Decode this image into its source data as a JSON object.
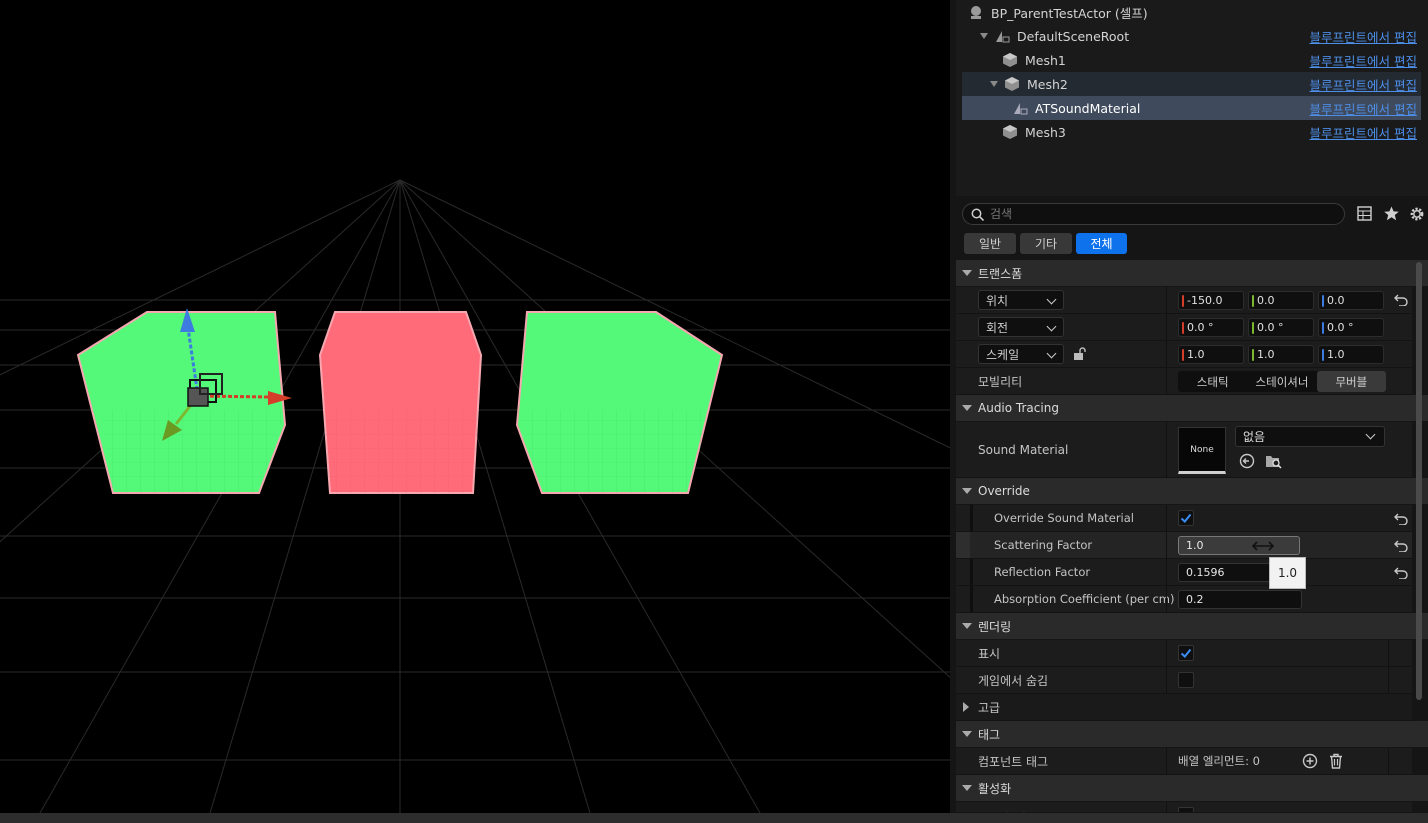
{
  "tree": {
    "items": [
      {
        "name": "BP_ParentTestActor (셀프)",
        "link": ""
      },
      {
        "name": "DefaultSceneRoot",
        "link": "블루프린트에서 편집"
      },
      {
        "name": "Mesh1",
        "link": "블루프린트에서 편집"
      },
      {
        "name": "Mesh2",
        "link": "블루프린트에서 편집"
      },
      {
        "name": "ATSoundMaterial",
        "link": "블루프린트에서 편집"
      },
      {
        "name": "Mesh3",
        "link": "블루프린트에서 편집"
      }
    ]
  },
  "search": {
    "placeholder": "검색"
  },
  "filter_tabs": [
    "일반",
    "기타",
    "전체"
  ],
  "transform": {
    "title": "트랜스폼",
    "location": {
      "label": "위치",
      "x": "-150.0",
      "y": "0.0",
      "z": "0.0"
    },
    "rotation": {
      "label": "회전",
      "x": "0.0 °",
      "y": "0.0 °",
      "z": "0.0 °"
    },
    "scale": {
      "label": "스케일",
      "x": "1.0",
      "y": "1.0",
      "z": "1.0"
    },
    "mobility": {
      "label": "모빌리티",
      "options": [
        "스태틱",
        "스테이셔너",
        "무버블"
      ],
      "selected": "무버블"
    }
  },
  "audio_tracing": {
    "title": "Audio Tracing",
    "sound_material": {
      "label": "Sound Material",
      "thumb": "None",
      "value": "없음"
    }
  },
  "override": {
    "title": "Override",
    "override_sound_material": {
      "label": "Override Sound Material",
      "checked": true
    },
    "scattering_factor": {
      "label": "Scattering Factor",
      "value": "1.0"
    },
    "reflection_factor": {
      "label": "Reflection Factor",
      "value": "0.1596"
    },
    "absorption": {
      "label": "Absorption Coefficient (per cm)",
      "value": "0.2"
    },
    "tooltip": "1.0"
  },
  "rendering": {
    "title": "렌더링",
    "visible": {
      "label": "표시",
      "checked": true
    },
    "hidden_in_game": {
      "label": "게임에서 숨김",
      "checked": false
    }
  },
  "advanced": {
    "title": "고급"
  },
  "tags": {
    "title": "태그",
    "component_tags": {
      "label": "컴포넌트 태그",
      "value": "배열 엘리먼트: 0"
    }
  },
  "activation": {
    "title": "활성화",
    "partial_label": "자동 활성화"
  },
  "colors": {
    "accent": "#0e72ed",
    "link": "#4d8ee8",
    "cube_green": "#55f97a",
    "cube_red": "#ff6b78",
    "axis_x": "#d33d2a",
    "axis_y": "#7cb82f",
    "axis_z": "#3d7be0"
  }
}
